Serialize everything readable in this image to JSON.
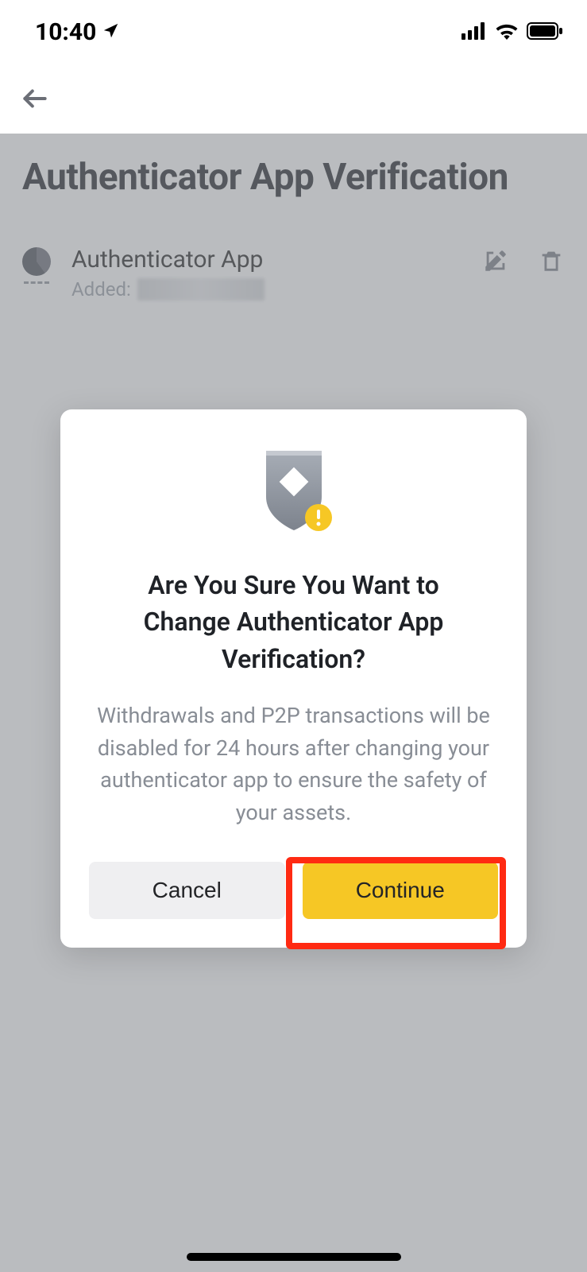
{
  "status": {
    "time": "10:40"
  },
  "nav": {},
  "page": {
    "title": "Authenticator App Verification",
    "device": {
      "name": "Authenticator App",
      "added_label": "Added:"
    }
  },
  "modal": {
    "title": "Are You Sure You Want to Change Authenticator App Verification?",
    "body": "Withdrawals and P2P transactions will be disabled for 24 hours after changing your authenticator app to ensure the safety of your assets.",
    "cancel": "Cancel",
    "continue": "Continue"
  }
}
